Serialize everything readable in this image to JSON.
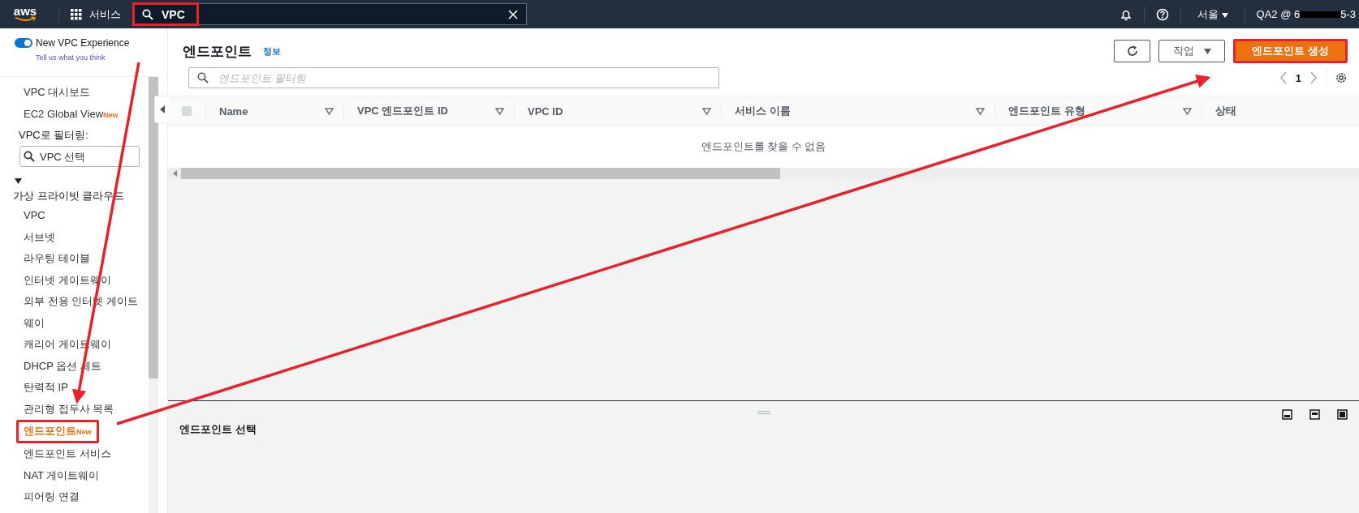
{
  "top_bar": {
    "logo": "aws",
    "services_label": "서비스",
    "search": {
      "value": "VPC",
      "highlighted": true
    },
    "region": "서울",
    "account": "QA2 @ 6",
    "account_tail": "5-3"
  },
  "sidebar": {
    "toggle": {
      "label": "New VPC Experience",
      "on": true
    },
    "feedback_link": "Tell us what you think",
    "items": [
      {
        "kind": "link",
        "label": "VPC 대시보드",
        "selected": false
      },
      {
        "kind": "link",
        "label": "EC2 Global View",
        "badge": "New",
        "selected": false
      },
      {
        "kind": "label",
        "label": "VPC로 필터링:"
      },
      {
        "kind": "filter",
        "placeholder": "VPC 선택"
      },
      {
        "kind": "section",
        "label": "가상 프라이빗 클라우드",
        "expanded": true,
        "children": [
          {
            "label": "VPC",
            "selected": false,
            "highlighted": false
          },
          {
            "label": "서브넷",
            "selected": false,
            "highlighted": false
          },
          {
            "label": "라우팅 테이블",
            "selected": false,
            "highlighted": false
          },
          {
            "label": "인터넷 게이트웨이",
            "selected": false,
            "highlighted": false
          },
          {
            "label": "외부 전용 인터넷 게이트웨이",
            "selected": false,
            "highlighted": false
          },
          {
            "label": "캐리어 게이트웨이",
            "selected": false,
            "highlighted": false
          },
          {
            "label": "DHCP 옵션 세트",
            "selected": false,
            "highlighted": false
          },
          {
            "label": "탄력적 IP",
            "selected": false,
            "highlighted": false
          },
          {
            "label": "관리형 접두사 목록",
            "selected": false,
            "highlighted": false
          },
          {
            "label": "엔드포인트",
            "badge": "New",
            "selected": true,
            "highlighted": true
          },
          {
            "label": "엔드포인트 서비스",
            "selected": false,
            "highlighted": false
          },
          {
            "label": "NAT 게이트웨이",
            "selected": false,
            "highlighted": false
          },
          {
            "label": "피어링 연결",
            "selected": false,
            "highlighted": false
          }
        ]
      }
    ]
  },
  "main": {
    "title": "엔드포인트",
    "info_link": "정보",
    "actions_button": "작업",
    "create_button": {
      "label": "엔드포인트 생성",
      "highlighted": true
    },
    "filter": {
      "placeholder": "엔드포인트 필터링"
    },
    "page": "1",
    "table": {
      "select_all": {
        "checked": false
      },
      "columns": [
        {
          "label": "Name",
          "sortable": true
        },
        {
          "label": "VPC 엔드포인트 ID",
          "sortable": true
        },
        {
          "label": "VPC ID",
          "sortable": true
        },
        {
          "label": "서비스 이름",
          "sortable": true
        },
        {
          "label": "엔드포인트 유형",
          "sortable": true
        },
        {
          "label": "상태",
          "sortable": false
        }
      ],
      "empty_message": "엔드포인트를 찾을 수 없음"
    },
    "detail_panel": {
      "title": "엔드포인트 선택"
    }
  }
}
